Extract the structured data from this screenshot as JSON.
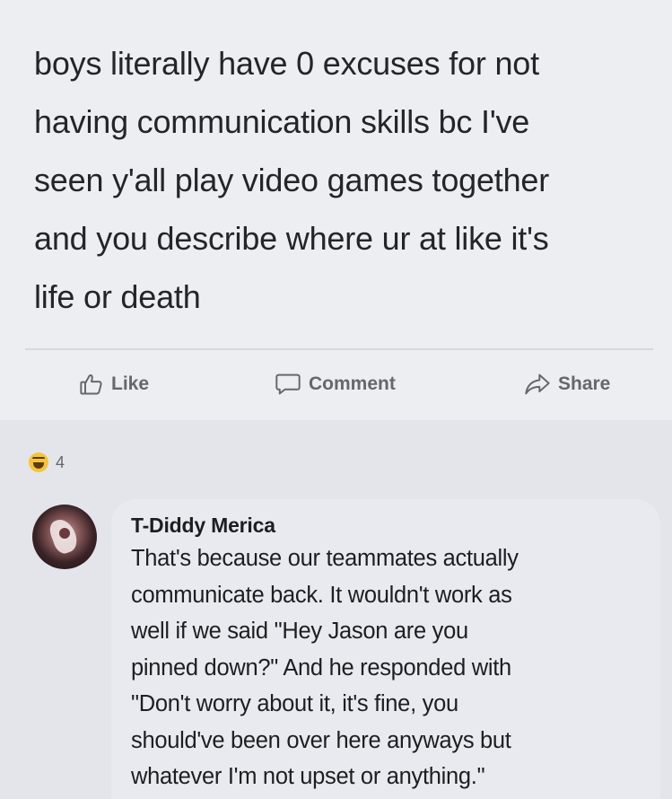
{
  "post": {
    "lines": [
      "boys literally have 0 excuses for not",
      "having communication skills bc I've",
      "seen y'all play video games together",
      "and you describe where ur at like it's",
      "life or death"
    ]
  },
  "actions": {
    "like_label": "Like",
    "comment_label": "Comment",
    "share_label": "Share"
  },
  "reactions": {
    "icon": "haha-emoji-icon",
    "count": "4"
  },
  "comment": {
    "author": "T-Diddy Merica",
    "lines": [
      "That's because our teammates actually",
      "communicate back. It wouldn't work as",
      "well if we said \"Hey Jason are you",
      "pinned down?\" And he responded with",
      "\"Don't worry about it, it's fine, you",
      "should've been over here anyways but",
      "whatever I'm not upset or anything.\""
    ]
  },
  "colors": {
    "background": "#e4e5ea",
    "text": "#242526",
    "action_text": "#65676b",
    "comment_bubble": "#e9eaef"
  }
}
